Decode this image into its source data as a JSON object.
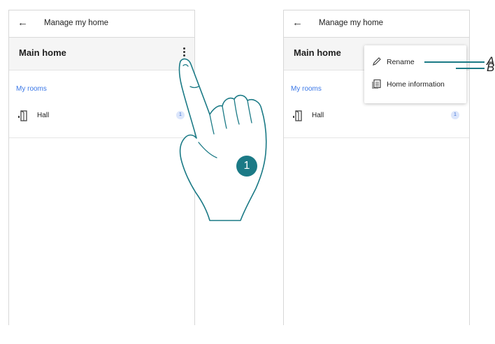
{
  "left_screen": {
    "back_icon": "arrow-left-icon",
    "title": "Manage my home",
    "home_name": "Main home",
    "more_icon": "more-vert-icon",
    "rooms_label": "My rooms",
    "rooms": [
      {
        "name": "Hall",
        "icon": "door-icon",
        "count": "1"
      }
    ]
  },
  "right_screen": {
    "back_icon": "arrow-left-icon",
    "title": "Manage my home",
    "home_name": "Main home",
    "rooms_label": "My rooms",
    "rooms": [
      {
        "name": "Hall",
        "icon": "door-icon",
        "count": "1"
      }
    ],
    "menu": [
      {
        "label": "Rename",
        "icon": "pencil-icon",
        "callout": "A"
      },
      {
        "label": "Home information",
        "icon": "document-icon",
        "callout": "B"
      }
    ]
  },
  "step_number": "1",
  "colors": {
    "accent": "#1b7a86",
    "link": "#3b78e7",
    "badge_bg": "#dce6fb"
  }
}
